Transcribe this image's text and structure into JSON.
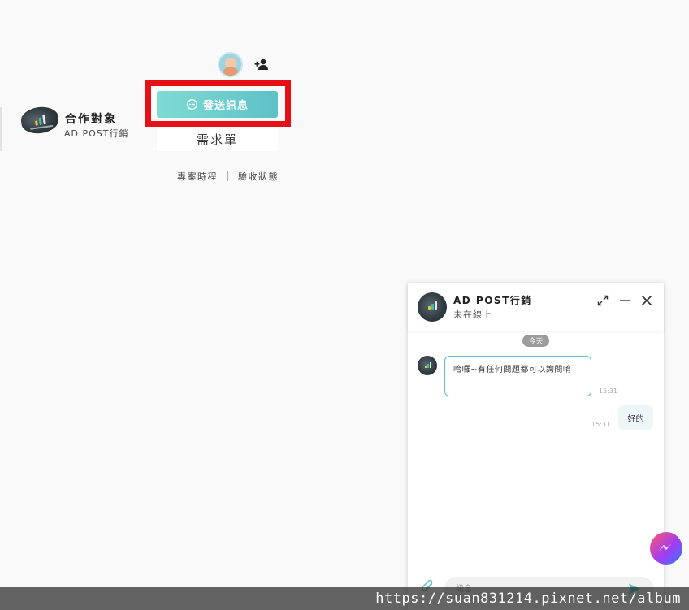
{
  "partner": {
    "title": "合作對象",
    "company": "AD POST行銷"
  },
  "actions": {
    "send_message_label": "發送訊息",
    "request_form_label": "需求單",
    "links": [
      "專案時程",
      "驗收狀態"
    ]
  },
  "chat": {
    "name": "AD POST行銷",
    "status": "未在線上",
    "date_label": "今天",
    "messages": [
      {
        "side": "in",
        "text": "哈囉~有任何問題都可以詢問唷",
        "time": "15:31"
      },
      {
        "side": "out",
        "text": "好的",
        "time": "15:31"
      }
    ],
    "input_placeholder": "訊息"
  },
  "watermark": "https://suan831214.pixnet.net/album",
  "colors": {
    "accent": "#5ec1c8",
    "highlight": "#e50f15",
    "background": "#f9f9f9"
  },
  "icons": {
    "send_button": "chat-bubble-icon",
    "add_friend": "add-user-icon",
    "expand": "expand-icon",
    "minimize": "minimize-icon",
    "close": "close-icon",
    "attach": "paperclip-icon",
    "send": "send-icon",
    "fab": "messenger-icon"
  }
}
